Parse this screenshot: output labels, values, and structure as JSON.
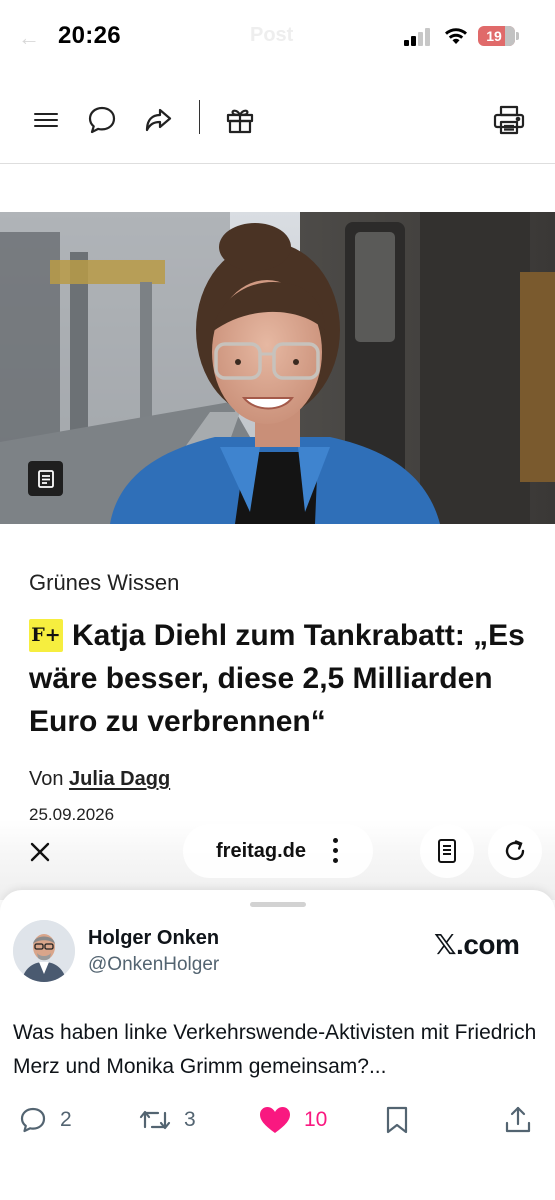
{
  "status_bar": {
    "time": "20:26",
    "battery": "19",
    "ghost_title": "Post"
  },
  "toolbar": {
    "icons": [
      "menu-icon",
      "comment-icon",
      "share-icon",
      "gift-icon",
      "print-icon"
    ]
  },
  "article": {
    "category": "Grünes Wissen",
    "badge": "F+",
    "headline": "Katja Diehl zum Tankrabatt: „Es wäre besser, diese 2,5 Milliarden Euro zu verbrennen“",
    "byline_prefix": "Von",
    "author": "Julia Dagg",
    "date": "25.09.2026"
  },
  "browser": {
    "url": "freitag.de"
  },
  "tweet": {
    "name": "Holger Onken",
    "handle": "@OnkenHolger",
    "platform": "𝕏.com",
    "text": "Was haben linke Verkehrswende-Aktivisten mit Friedrich Merz und Monika Grimm gemeinsam?...",
    "replies": "2",
    "retweets": "3",
    "likes": "10"
  },
  "colors": {
    "plus_badge": "#f6ee3f",
    "like": "#f91880",
    "secondary_text": "#536471",
    "battery_low": "#e06a6a"
  }
}
